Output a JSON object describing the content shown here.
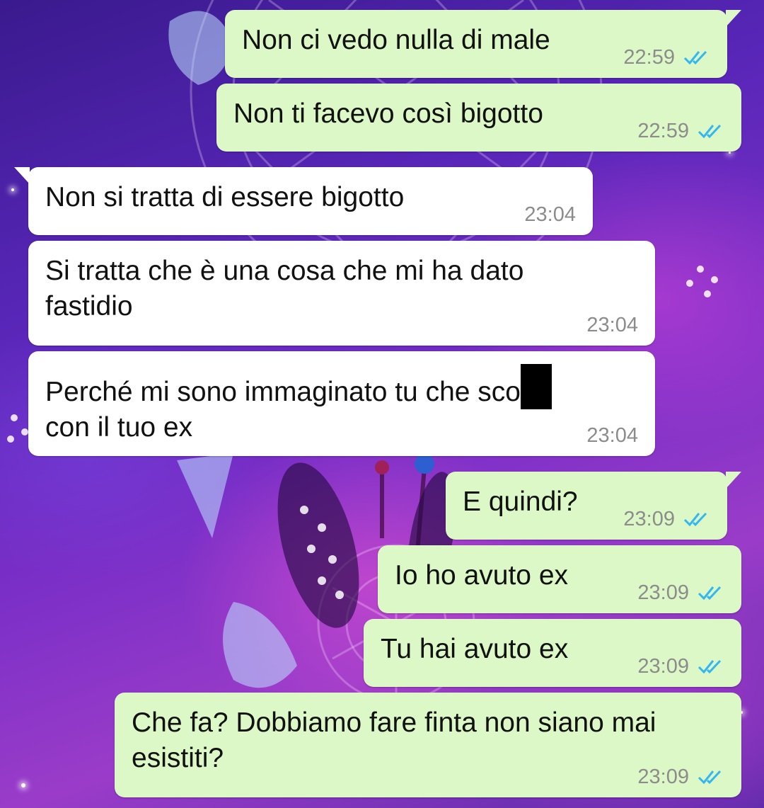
{
  "colors": {
    "outgoing_bubble": "#dcf8c6",
    "incoming_bubble": "#ffffff",
    "read_ticks": "#34b7f1",
    "timestamp": "#8c8c8c",
    "wallpaper": "#6a2fc0"
  },
  "messages": [
    {
      "direction": "outgoing",
      "text": "Non ci vedo nulla di male",
      "time": "22:59",
      "status_icon": "double-check-read-icon"
    },
    {
      "direction": "outgoing",
      "text": "Non ti facevo così bigotto",
      "time": "22:59",
      "status_icon": "double-check-read-icon"
    },
    {
      "direction": "incoming",
      "text": "Non si tratta di essere bigotto",
      "time": "23:04"
    },
    {
      "direction": "incoming",
      "text": "Si tratta che è una cosa che mi ha dato\nfastidio",
      "time": "23:04"
    },
    {
      "direction": "incoming",
      "text_before_redaction": "Perché mi sono immaginato tu che sco",
      "text_after_redaction": "\ncon il tuo ex",
      "redacted": true,
      "time": "23:04"
    },
    {
      "direction": "outgoing",
      "text": "E quindi?",
      "time": "23:09",
      "status_icon": "double-check-read-icon"
    },
    {
      "direction": "outgoing",
      "text": "Io ho avuto ex",
      "time": "23:09",
      "status_icon": "double-check-read-icon"
    },
    {
      "direction": "outgoing",
      "text": "Tu hai avuto ex",
      "time": "23:09",
      "status_icon": "double-check-read-icon"
    },
    {
      "direction": "outgoing",
      "text": "Che fa? Dobbiamo fare finta non siano mai\nesistiti?",
      "time": "23:09",
      "status_icon": "double-check-read-icon"
    }
  ]
}
